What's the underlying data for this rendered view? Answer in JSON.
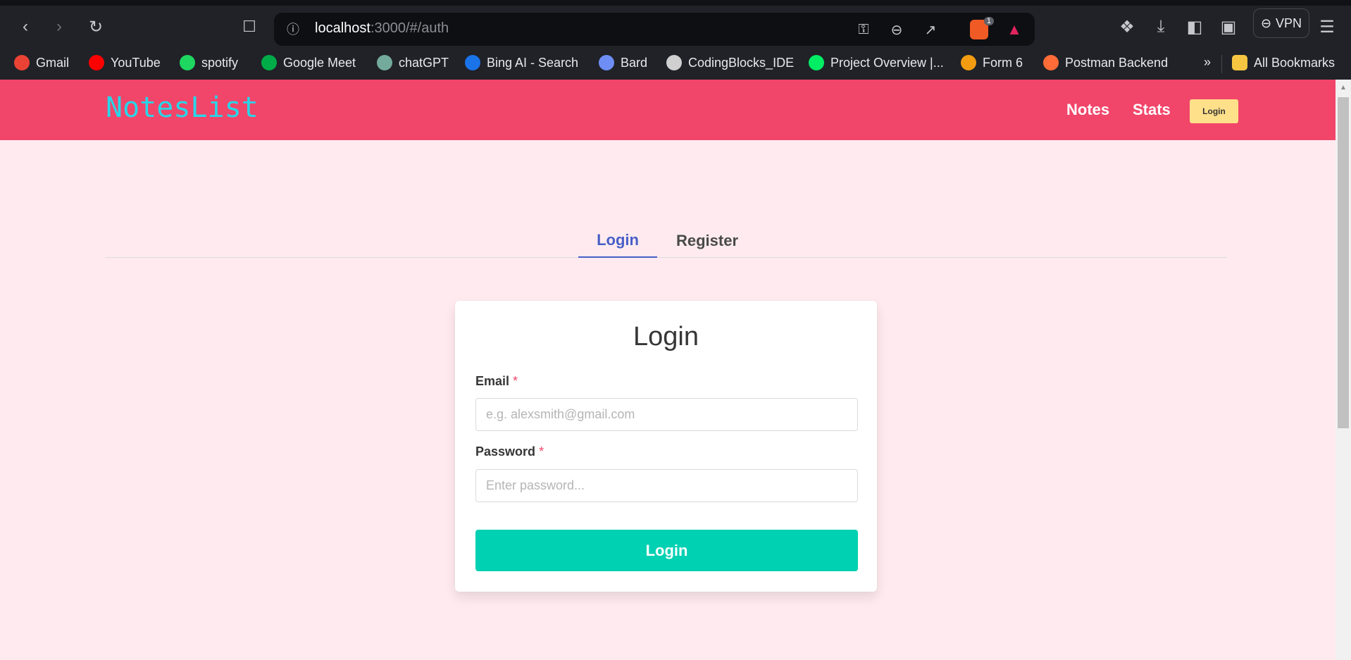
{
  "browser": {
    "url_host": "localhost",
    "url_path": ":3000/#/auth",
    "shields_count": "1",
    "vpn_label": "VPN",
    "bookmarks": [
      {
        "label": "Gmail",
        "color": "#ea4335"
      },
      {
        "label": "YouTube",
        "color": "#ff0000"
      },
      {
        "label": "spotify",
        "color": "#1ed760"
      },
      {
        "label": "Google Meet",
        "color": "#00ac47"
      },
      {
        "label": "chatGPT",
        "color": "#74aa9c"
      },
      {
        "label": "Bing AI - Search",
        "color": "#1a73e8"
      },
      {
        "label": "Bard",
        "color": "#6e8ef5"
      },
      {
        "label": "CodingBlocks_IDE",
        "color": "#d0d0d0"
      },
      {
        "label": "Project Overview |...",
        "color": "#00ed64"
      },
      {
        "label": "Form 6",
        "color": "#f39c12"
      },
      {
        "label": "Postman Backend",
        "color": "#ff6c37"
      }
    ],
    "overflow_label": "»",
    "all_bookmarks_label": "All Bookmarks"
  },
  "header": {
    "logo": "NotesList",
    "nav": [
      "Notes",
      "Stats"
    ],
    "login_button": "Login",
    "colors": {
      "bg": "#f1456a",
      "logo": "#28d6e8",
      "login_bg": "#ffe08a"
    }
  },
  "tabs": [
    {
      "label": "Login",
      "active": true
    },
    {
      "label": "Register",
      "active": false
    }
  ],
  "form": {
    "title": "Login",
    "email_label": "Email",
    "email_placeholder": "e.g. alexsmith@gmail.com",
    "email_value": "",
    "password_label": "Password",
    "password_placeholder": "Enter password...",
    "password_value": "",
    "required_mark": "*",
    "submit_label": "Login",
    "submit_color": "#00d1b2"
  }
}
